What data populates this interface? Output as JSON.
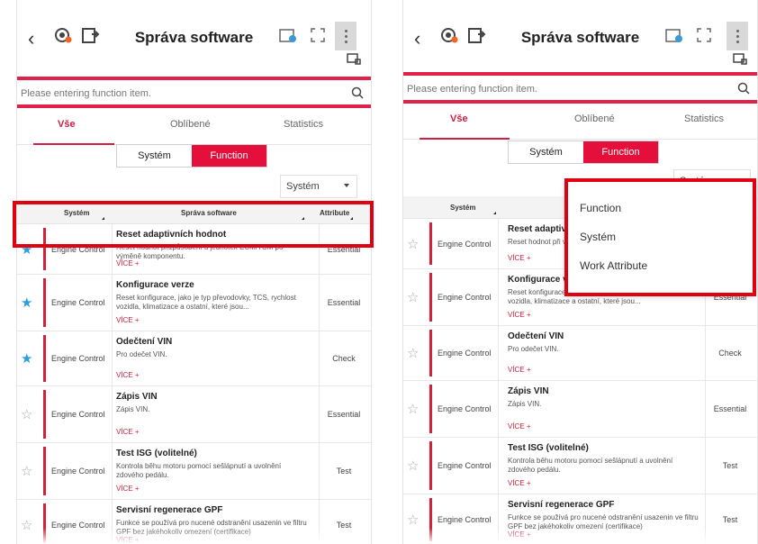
{
  "screens": [
    {
      "title": "Správa software",
      "search": {
        "placeholder": "Please entering function item."
      },
      "tabs": [
        "Vše",
        "Oblíbené",
        "Statistics"
      ],
      "segment": {
        "left": "Systém",
        "right": "Function"
      },
      "dropdown": {
        "selected": "Systém"
      },
      "columns": {
        "system": "Systém",
        "function": "Správa software",
        "attribute": "Attribute"
      },
      "rows": [
        {
          "favorite": true,
          "system": "Engine Control",
          "name": "Reset adaptivních hodnot",
          "desc": "Reset hodnot přizpůsobení u jednotek ECM/TCM po výměně komponentu.",
          "more": "VÍCE +",
          "attribute": "Essential"
        },
        {
          "favorite": true,
          "system": "Engine Control",
          "name": "Konfigurace verze",
          "desc": "Reset konfigurace, jako je typ převodovky, TCS, rychlost vozidla, klimatizace a ostatní, které jsou...",
          "more": "VÍCE +",
          "attribute": "Essential"
        },
        {
          "favorite": true,
          "system": "Engine Control",
          "name": "Odečtení VIN",
          "desc": "Pro odečet VIN.",
          "more": "VÍCE +",
          "attribute": "Check"
        },
        {
          "favorite": false,
          "system": "Engine Control",
          "name": "Zápis VIN",
          "desc": "Zápis VIN.",
          "more": "VÍCE +",
          "attribute": "Essential"
        },
        {
          "favorite": false,
          "system": "Engine Control",
          "name": "Test ISG (volitelné)",
          "desc": "Kontrola běhu motoru pomocí sešlápnutí a uvolnění zdového pedálu.",
          "more": "VÍCE +",
          "attribute": "Test"
        },
        {
          "favorite": false,
          "system": "Engine Control",
          "name": "Servisní regenerace GPF",
          "desc": "Funkce se používá pro nucené odstranění usazenin ve filtru GPF bez jakéhokoliv omezení (certifikace)",
          "more": "VÍCE +",
          "attribute": "Test"
        }
      ]
    },
    {
      "title": "Správa software",
      "search": {
        "placeholder": "Please entering function item."
      },
      "tabs": [
        "Vše",
        "Oblíbené",
        "Statistics"
      ],
      "segment": {
        "left": "Systém",
        "right": "Function"
      },
      "dropdown": {
        "selected": "Systém"
      },
      "columns": {
        "system": "Systém"
      },
      "rows": [
        {
          "favorite": false,
          "system": "Engine Control",
          "name": "Reset adaptivní",
          "desc": "Reset hodnot při výměně kompone",
          "more": "VÍCE +",
          "attribute": ""
        },
        {
          "favorite": false,
          "system": "Engine Control",
          "name": "Konfigurace verze",
          "desc": "Reset konfigurace, jako je typ převodovky, TCS, rychlost vozidla, klimatizace a ostatní, které jsou...",
          "more": "VÍCE +",
          "attribute": "Essential"
        },
        {
          "favorite": false,
          "system": "Engine Control",
          "name": "Odečtení VIN",
          "desc": "Pro odečet VIN.",
          "more": "VÍCE +",
          "attribute": "Check"
        },
        {
          "favorite": false,
          "system": "Engine Control",
          "name": "Zápis VIN",
          "desc": "Zápis VIN.",
          "more": "VÍCE +",
          "attribute": "Essential"
        },
        {
          "favorite": false,
          "system": "Engine Control",
          "name": "Test ISG (volitelné)",
          "desc": "Kontrola běhu motoru pomocí sešlápnutí a uvolnění zdového pedálu.",
          "more": "VÍCE +",
          "attribute": "Test"
        },
        {
          "favorite": false,
          "system": "Engine Control",
          "name": "Servisní regenerace GPF",
          "desc": "Funkce se používá pro nucené odstranění usazenin ve filtru GPF bez jakéhokoliv omezení (certifikace)",
          "more": "VÍCE +",
          "attribute": "Test"
        }
      ],
      "sort_menu": [
        "Function",
        "Systém",
        "Work Attribute"
      ]
    }
  ],
  "colors": {
    "accent": "#e0224a",
    "favorite_star": "#2aa0e0",
    "highlight_box": "#e00012"
  },
  "icons": [
    "back-icon",
    "engine-icon",
    "export-icon",
    "vci-icon",
    "fullscreen-icon",
    "more-vert-icon",
    "car-icon",
    "search-icon",
    "star-icon"
  ]
}
